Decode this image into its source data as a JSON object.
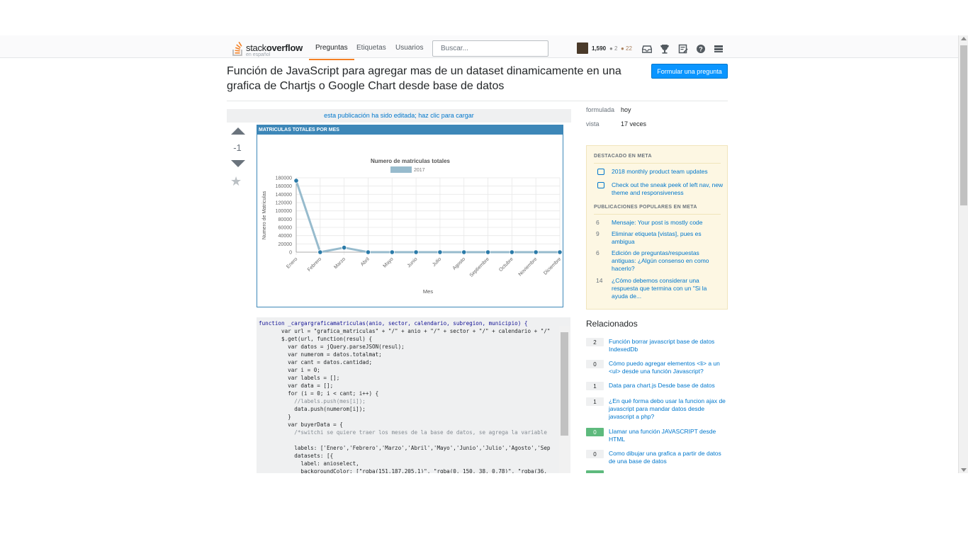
{
  "header": {
    "logo_prefix": "stack",
    "logo_bold": "overflow",
    "logo_sub": "en español",
    "nav": [
      "Preguntas",
      "Etiquetas",
      "Usuarios"
    ],
    "search_placeholder": "Buscar...",
    "reputation": "1,590",
    "silver": "● 2",
    "bronze": "● 22"
  },
  "question": {
    "title": "Función de JavaScript para agregar mas de un dataset dinamicamente en una grafica de Chartjs o Google Chart desde base de datos",
    "ask_button": "Formular una pregunta",
    "edit_banner": "esta publicación ha sido editada; haz clic para cargar",
    "votes": "-1"
  },
  "embedded_panel": {
    "header": "MATRICULAS TOTALES POR MES"
  },
  "chart_data": {
    "type": "line",
    "title": "Numero de matriculas totales",
    "xlabel": "Mes",
    "ylabel": "Numero de Matriculas",
    "categories": [
      "Enero",
      "Febrero",
      "Marzo",
      "Abril",
      "Mayo",
      "Junio",
      "Julio",
      "Agosto",
      "Septiembre",
      "Octubre",
      "Noviembre",
      "Diciembre"
    ],
    "series": [
      {
        "name": "2017",
        "values": [
          173000,
          0,
          11000,
          0,
          0,
          0,
          0,
          0,
          0,
          0,
          0,
          0
        ],
        "color": "#97bbcd",
        "point_color": "#2a7aa8"
      }
    ],
    "ylim": [
      0,
      180000
    ],
    "yticks": [
      0,
      20000,
      40000,
      60000,
      80000,
      100000,
      120000,
      140000,
      160000,
      180000
    ],
    "legend": "top",
    "grid": true
  },
  "code": [
    {
      "t": "function _cargargraficamatriculas(anio, sector, calendario, subregion, municipio) {",
      "c": "kw"
    },
    {
      "t": "       var url = \"grafica_matriculas\" + \"/\" + anio + \"/\" + sector + \"/\" + calendario + \"/\"",
      "c": ""
    },
    {
      "t": "       $.get(url, function(resul) {",
      "c": ""
    },
    {
      "t": "         var datos = jQuery.parseJSON(resul);",
      "c": ""
    },
    {
      "t": "         var numerom = datos.totalmat;",
      "c": ""
    },
    {
      "t": "         var cant = datos.cantidad;",
      "c": ""
    },
    {
      "t": "         var i = 0;",
      "c": ""
    },
    {
      "t": "         var labels = [];",
      "c": ""
    },
    {
      "t": "         var data = [];",
      "c": ""
    },
    {
      "t": "         for (i = 0; i < cant; i++) {",
      "c": ""
    },
    {
      "t": "           //labels.push(mes[i]);",
      "c": "cm"
    },
    {
      "t": "           data.push(numerom[i]);",
      "c": ""
    },
    {
      "t": "         }",
      "c": ""
    },
    {
      "t": "         var buyerData = {",
      "c": ""
    },
    {
      "t": "           /*switchi se quiere traer los meses de la base de datos, se agrega la variable",
      "c": "cm"
    },
    {
      "t": "",
      "c": ""
    },
    {
      "t": "           labels: ['Enero','Febrero','Marzo','Abril','Mayo','Junio','Julio','Agosto','Sep",
      "c": ""
    },
    {
      "t": "           datasets: [{",
      "c": ""
    },
    {
      "t": "             label: anioselect,",
      "c": ""
    },
    {
      "t": "             backgroundColor: [\"rgba(151,187,205,1)\", \"rgba(0, 150, 38, 0.78)\", \"rgba(36, ",
      "c": ""
    }
  ],
  "meta": {
    "asked_label": "formulada",
    "asked_value": "hoy",
    "viewed_label": "vista",
    "viewed_value": "17 veces"
  },
  "featured": {
    "heading1": "DESTACADO EN META",
    "items1": [
      "2018 monthly product team updates",
      "Check out the sneak peek of left nav, new theme and responsiveness"
    ],
    "heading2": "PUBLICACIONES POPULARES EN META",
    "items2": [
      {
        "n": "6",
        "t": "Mensaje: Your post is mostly code"
      },
      {
        "n": "9",
        "t": "Eliminar etiqueta [vistas], pues es ambigua"
      },
      {
        "n": "6",
        "t": "Edición de preguntas/respuestas antiguas: ¿Algún consenso en como hacerlo?"
      },
      {
        "n": "14",
        "t": "¿Cómo debemos considerar una respuesta que termina con un \"Si la ayuda de..."
      }
    ]
  },
  "related": {
    "heading": "Relacionados",
    "items": [
      {
        "score": "2",
        "answered": false,
        "t": "Función borrar javascript base de datos IndexedDb"
      },
      {
        "score": "0",
        "answered": false,
        "t": "Cómo puedo agregar elementos <li> a un <ul> desde una función Javascript?"
      },
      {
        "score": "1",
        "answered": false,
        "t": "Data para chart.js Desde base de datos"
      },
      {
        "score": "1",
        "answered": false,
        "t": "¿En qué forma debo usar la funcion ajax de javascript para mandar datos desde javascript a php?"
      },
      {
        "score": "0",
        "answered": true,
        "t": "Llamar una función JAVASCRIPT desde HTML"
      },
      {
        "score": "0",
        "answered": false,
        "t": "Como dibujar una grafica a partir de datos de una base de datos"
      }
    ]
  }
}
